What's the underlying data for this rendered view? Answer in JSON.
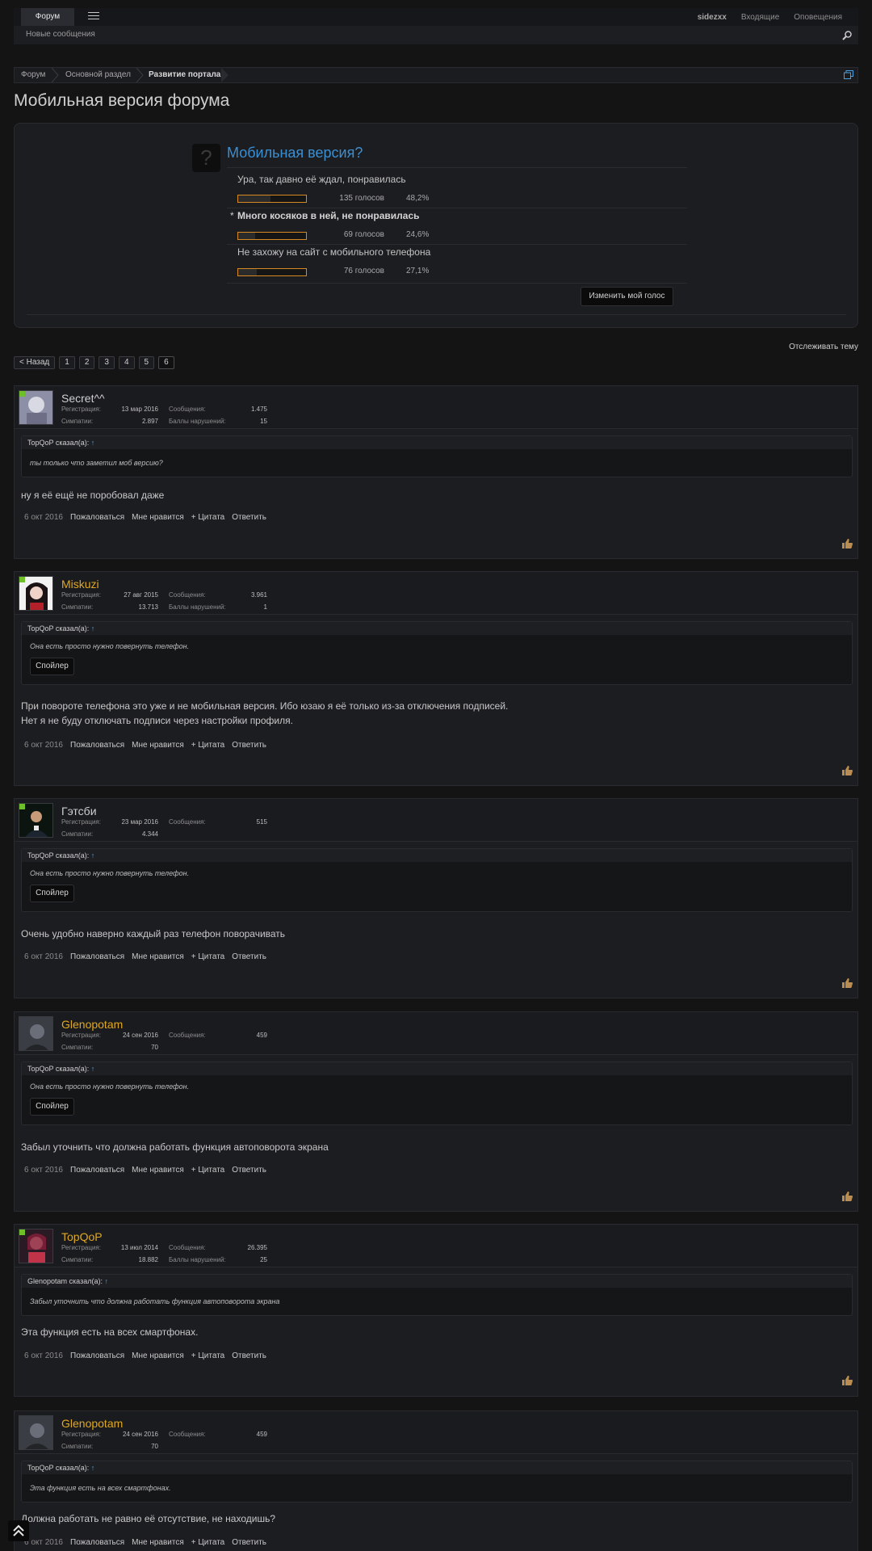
{
  "nav": {
    "forum_tab": "Форум",
    "new_messages": "Новые сообщения",
    "user": "sidezxx",
    "inbox": "Входящие",
    "alerts": "Оповещения"
  },
  "breadcrumbs": [
    "Форум",
    "Основной раздел",
    "Развитие портала"
  ],
  "page_title": "Мобильная версия форума",
  "poll": {
    "question": "Мобильная версия?",
    "options": [
      {
        "label": "Ура, так давно её ждал, понравилась",
        "votes": "135 голосов",
        "percent": "48,2%",
        "fraction": 0.482
      },
      {
        "label": "Много косяков в ней, не понравилась",
        "votes": "69 голосов",
        "percent": "24,6%",
        "fraction": 0.246,
        "voted": "*"
      },
      {
        "label": "Не захожу на сайт с мобильного телефона",
        "votes": "76 голосов",
        "percent": "27,1%",
        "fraction": 0.271
      }
    ],
    "change_vote": "Изменить мой голос"
  },
  "watch_thread": "Отслеживать тему",
  "pager": {
    "prev": "< Назад",
    "pages": [
      "1",
      "2",
      "3",
      "4",
      "5",
      "6"
    ]
  },
  "labels": {
    "reg": "Регистрация:",
    "msgs": "Сообщения:",
    "likes": "Симпатии:",
    "warn": "Баллы нарушений:",
    "report": "Пожаловаться",
    "like": "Мне нравится",
    "quote": "+ Цитата",
    "reply": "Ответить",
    "spoiler": "Спойлер"
  },
  "posts": [
    {
      "name": "Secret^^",
      "reg": "13 мар 2016",
      "msgs": "1.475",
      "likes": "2.897",
      "warn": "15",
      "quote_author": "TopQoP сказал(а):",
      "quote_text": "ты только что заметил моб версию?",
      "message": "ну я её ещё не поробовал даже",
      "date": "6 окт 2016"
    },
    {
      "name": "Miskuzi",
      "reg": "27 авг 2015",
      "msgs": "3.961",
      "likes": "13.713",
      "warn": "1",
      "quote_author": "TopQoP сказал(а):",
      "quote_text": "Она есть просто нужно повернуть телефон.",
      "message_lines": [
        "При повороте телефона это уже и не мобильная версия. Ибо юзаю я её только из-за отключения подписей.",
        "Нет я не буду отключать подписи через настройки профиля."
      ],
      "date": "6 окт 2016"
    },
    {
      "name": "Гэтсби",
      "reg": "23 мар 2016",
      "msgs": "515",
      "likes": "4.344",
      "quote_author": "TopQoP сказал(а):",
      "quote_text": "Она есть просто нужно повернуть телефон.",
      "message": "Очень удобно наверно каждый раз телефон поворачивать",
      "date": "6 окт 2016"
    },
    {
      "name": "Glenopotam",
      "reg": "24 сен 2016",
      "msgs": "459",
      "likes": "70",
      "quote_author": "TopQoP сказал(а):",
      "quote_text": "Она есть просто нужно повернуть телефон.",
      "message": "Забыл уточнить что должна работать функция автоповорота экрана",
      "date": "6 окт 2016"
    },
    {
      "name": "TopQoP",
      "reg": "13 июл 2014",
      "msgs": "26.395",
      "likes": "18.882",
      "warn": "25",
      "quote_author": "Glenopotam сказал(а):",
      "quote_text": "Забыл уточнить что должна работать функция автоповорота экрана",
      "message": "Эта функция есть на всех смартфонах.",
      "date": "6 окт 2016"
    },
    {
      "name": "Glenopotam",
      "reg": "24 сен 2016",
      "msgs": "459",
      "likes": "70",
      "quote_author": "TopQoP сказал(а):",
      "quote_text": "Эта функция есть на всех смартфонах.",
      "message": "Должна работать не равно её отсутствие, не находишь?",
      "date": "6 окт 2016"
    }
  ]
}
